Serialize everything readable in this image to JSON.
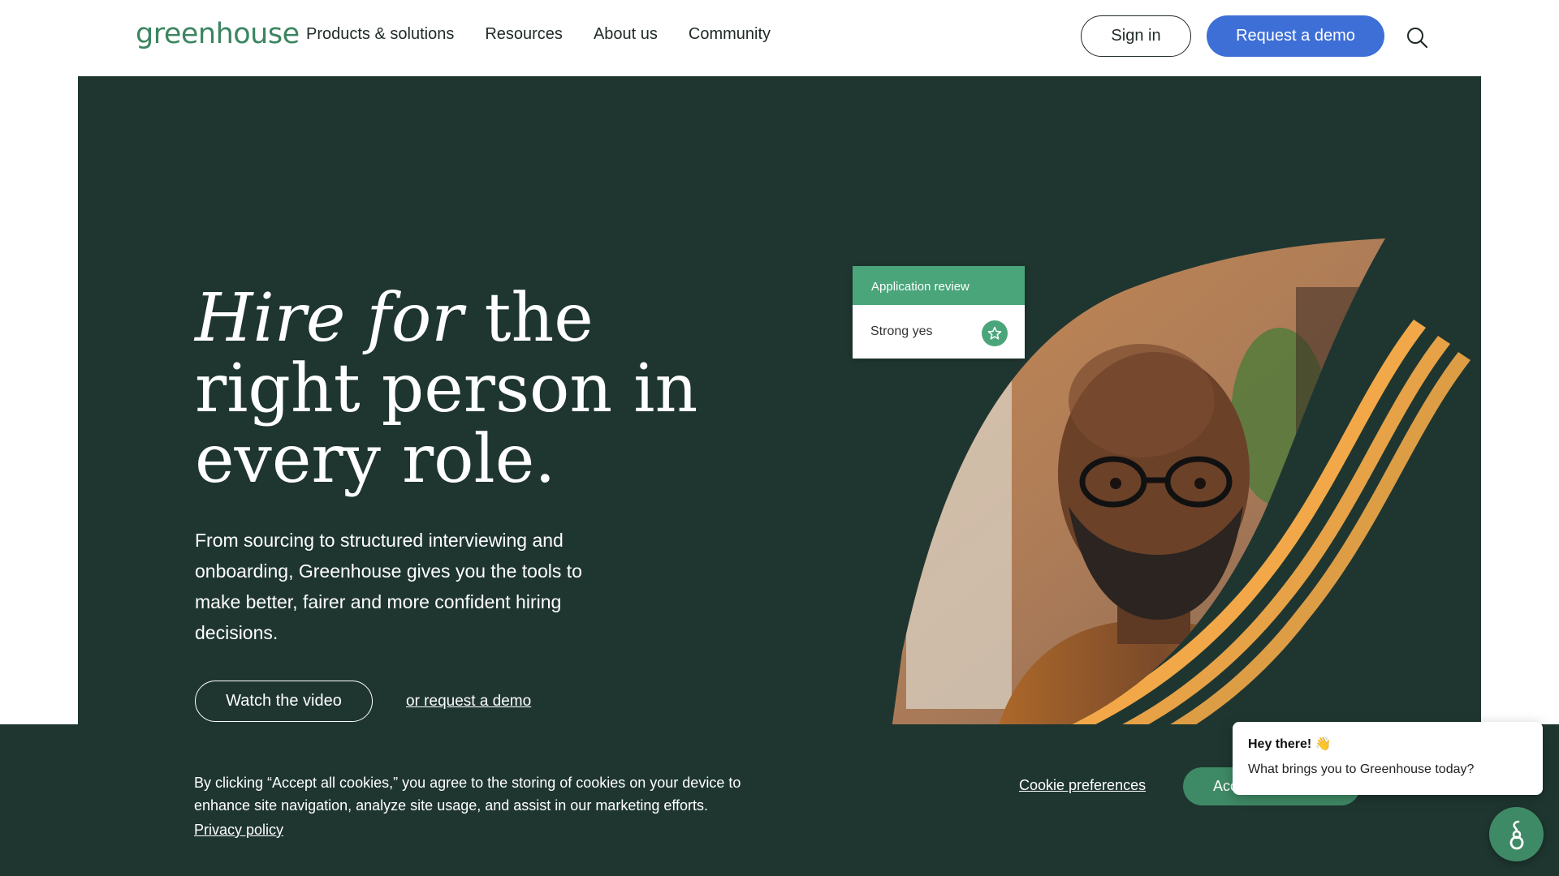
{
  "header": {
    "logo": "greenhouse",
    "nav": [
      "Products & solutions",
      "Resources",
      "About us",
      "Community"
    ],
    "signin_label": "Sign in",
    "demo_label": "Request a demo",
    "search_icon": "search-icon"
  },
  "hero": {
    "title_italic": "Hire for",
    "title_rest_1": " the",
    "title_line_2": "right person in",
    "title_line_3": "every role.",
    "description": "From sourcing to structured interviewing and onboarding, Greenhouse gives you the tools to make better, fairer and more confident hiring decisions.",
    "video_label": "Watch the video",
    "demo_link": "or request a demo",
    "review_card": {
      "header": "Application review",
      "value": "Strong yes",
      "icon": "star-icon"
    }
  },
  "cookie_banner": {
    "text": "By clicking “Accept all cookies,” you agree to the storing of cookies on your device to enhance site navigation, analyze site usage, and assist in our marketing efforts.",
    "privacy_link": "Privacy policy",
    "preferences_link": "Cookie preferences",
    "accept_label": "Acc"
  },
  "chat": {
    "greeting": "Hey there! 👋",
    "question": "What brings you to Greenhouse today?",
    "icon": "greenhouse-chat-icon"
  },
  "colors": {
    "brand_green": "#3b8561",
    "hero_bg": "#1f3630",
    "accent_blue": "#3d6fd6",
    "card_green": "#4aa57a",
    "stripe_orange": "#f2a848"
  }
}
